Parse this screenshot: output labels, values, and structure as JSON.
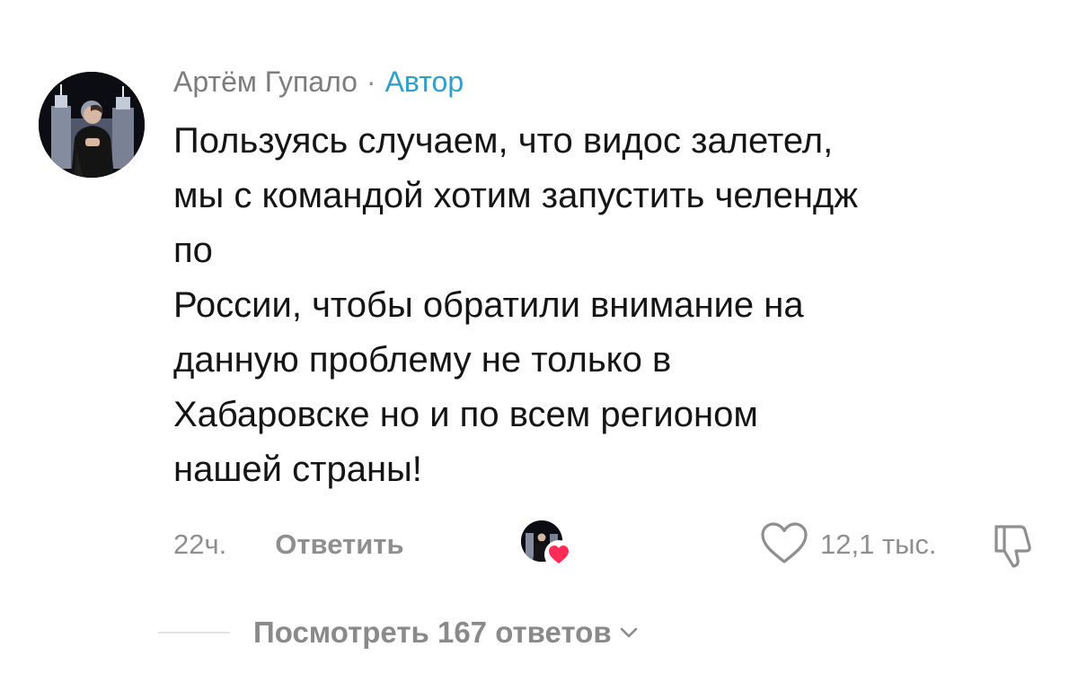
{
  "comment": {
    "author_name": "Артём Гупало",
    "separator": "·",
    "author_badge": "Автор",
    "text": "Пользуясь случаем, что видос залетел,\nмы с командой хотим запустить челендж\nпо\nРоссии, чтобы обратили внимание на\nданную проблему не только в\nХабаровске но и по всем регионом\nнашей страны!",
    "time": "22ч.",
    "reply_label": "Ответить",
    "likes_count": "12,1 тыс.",
    "creator_liked": true,
    "view_replies_label": "Посмотреть 167 ответов"
  },
  "icons": {
    "avatar": "author-avatar",
    "creator_heart": "heart-icon",
    "like": "heart-outline-icon",
    "dislike": "thumbs-down-icon",
    "expand": "chevron-down-icon"
  },
  "colors": {
    "author_name": "#7d7d7d",
    "author_badge": "#2f9fce",
    "text": "#151515",
    "meta": "#8f8f8f",
    "heart": "#fe2c55",
    "background": "#ffffff"
  }
}
